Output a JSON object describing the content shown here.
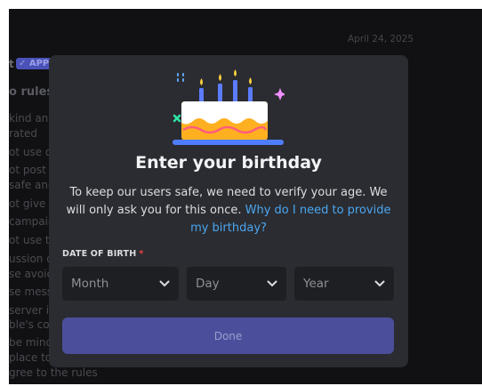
{
  "background": {
    "date": "April 24, 2025",
    "badge": "✓ APP",
    "heading_fragment": "o rules",
    "lines": [
      "t",
      "kind and c",
      "rated",
      "ot use o",
      "ot post",
      "safe and",
      "ot give a",
      "campaig",
      "ot use th",
      "ussion o",
      "se avoid",
      "se mess",
      "server i",
      "ble's con",
      "be mind",
      "place to",
      "gree to the rules"
    ]
  },
  "modal": {
    "title": "Enter your birthday",
    "subtitle": "To keep our users safe, we need to verify your age. We will only ask you for this once.",
    "help_link": "Why do I need to provide my birthday?",
    "dob_label": "DATE OF BIRTH",
    "required_mark": "*",
    "month_placeholder": "Month",
    "day_placeholder": "Day",
    "year_placeholder": "Year",
    "done_label": "Done"
  },
  "colors": {
    "modal_bg": "#2b2c31",
    "input_bg": "#1e1f22",
    "link": "#4aa6f0",
    "button_disabled": "#4b4f9b",
    "required": "#f23f43"
  },
  "icons": {
    "illustration": "birthday-cake-icon",
    "chevron": "chevron-down-icon"
  }
}
